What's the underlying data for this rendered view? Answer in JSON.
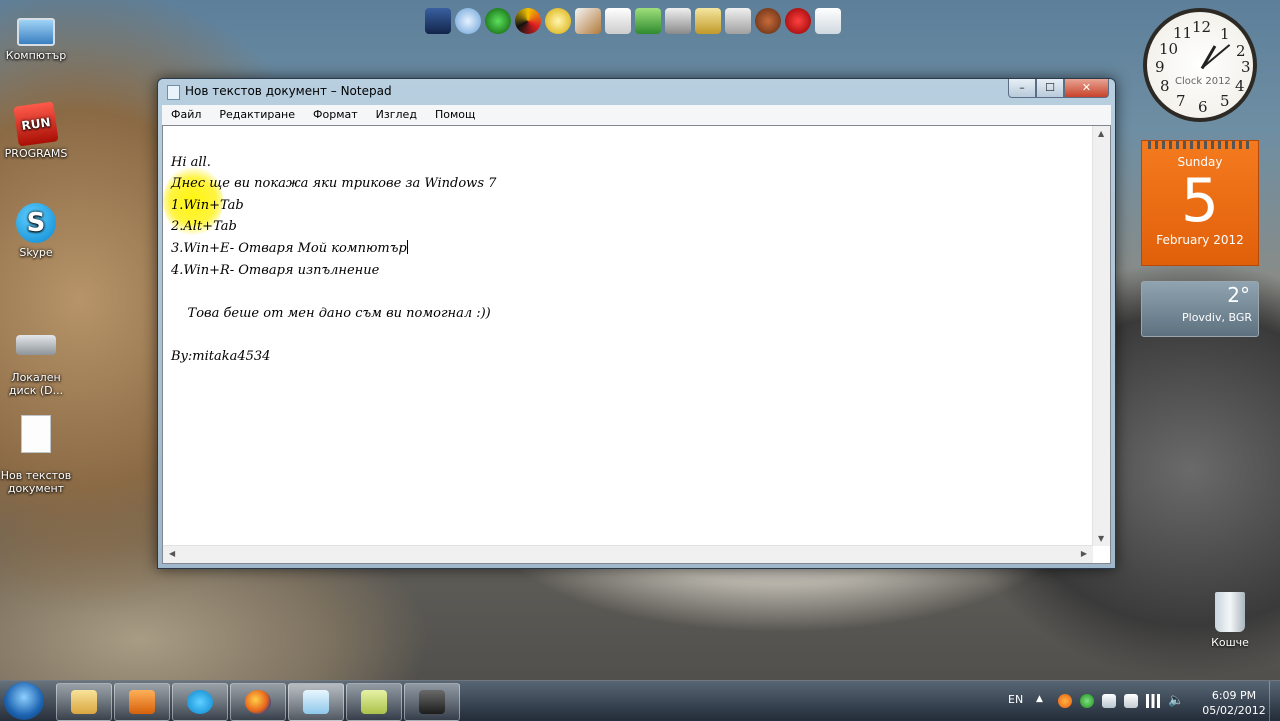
{
  "desktop": {
    "icons": [
      {
        "label": "Компютър"
      },
      {
        "label": "PROGRAMS",
        "badge": "RUN"
      },
      {
        "label": "Skype"
      },
      {
        "label": "Локален\nдиск (D..."
      },
      {
        "label": "Нов текстов\nдокумент"
      }
    ],
    "recycle_bin": "Кошче"
  },
  "gadgets": {
    "clock": {
      "brand": "Clock 2012",
      "numbers": [
        "12",
        "1",
        "2",
        "3",
        "4",
        "5",
        "6",
        "7",
        "8",
        "9",
        "10",
        "11"
      ]
    },
    "calendar": {
      "weekday": "Sunday",
      "day": "5",
      "month_year": "February 2012"
    },
    "weather": {
      "temp": "2°",
      "city": "Plovdiv, BGR"
    }
  },
  "notepad": {
    "title": "Нов текстов документ – Notepad",
    "window_controls": {
      "minimize": "–",
      "maximize": "☐",
      "close": "✕"
    },
    "menu": [
      "Файл",
      "Редактиране",
      "Формат",
      "Изглед",
      "Помощ"
    ],
    "lines": [
      "Hi all.",
      "Днес ще ви покажа яки трикове за Windows 7",
      "1.Win+Tab",
      "2.Alt+Tab",
      "3.Win+E- Отваря Мой компютър",
      "4.Win+R- Отваря изпълнение",
      "",
      "    Това беше от мен дано съм ви помогнал :))",
      "",
      "By:mitaka4534"
    ]
  },
  "taskbar": {
    "language": "EN",
    "time": "6:09 PM",
    "date": "05/02/2012",
    "pinned": [
      "explorer-icon",
      "media-player-icon",
      "skype-icon",
      "firefox-icon",
      "notepad-icon",
      "sticky-notes-icon",
      "camera-icon"
    ]
  }
}
